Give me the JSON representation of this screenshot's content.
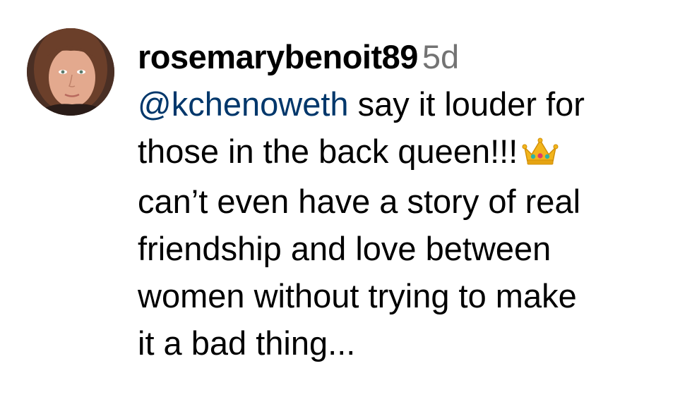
{
  "comment": {
    "username": "rosemarybenoit89",
    "timestamp": "5d",
    "mention": "@kchenoweth",
    "line1_rest": " say it louder for",
    "line2": "those in the back queen!!!",
    "emoji": "crown-emoji",
    "line3": "can’t even have a story of real",
    "line4": "friendship and love between",
    "line5": "women without trying to make",
    "line6": "it a bad thing..."
  },
  "colors": {
    "mention": "#00376b",
    "timestamp": "#737373",
    "text": "#000000"
  }
}
